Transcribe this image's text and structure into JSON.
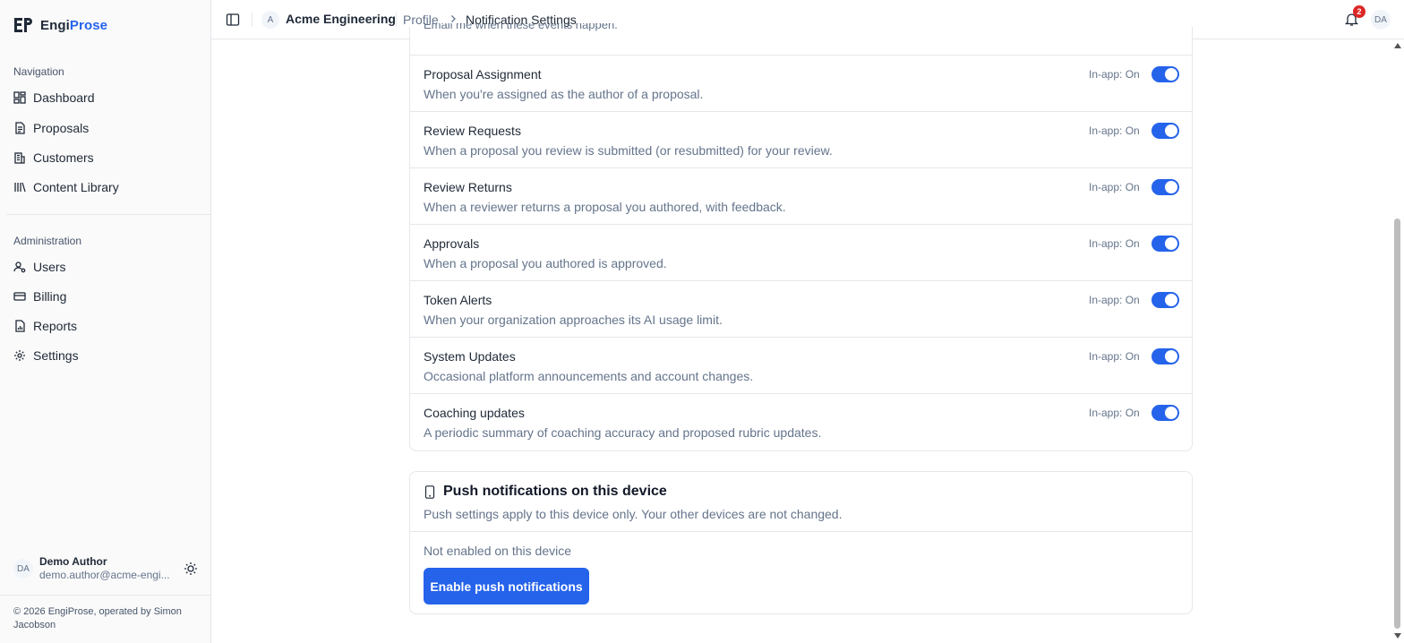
{
  "brand": {
    "name_prefix": "Engi",
    "name_accent": "Prose",
    "accent_color": "#2563eb"
  },
  "sidebar": {
    "nav_label": "Navigation",
    "nav_items": [
      {
        "label": "Dashboard",
        "icon": "dashboard-icon"
      },
      {
        "label": "Proposals",
        "icon": "document-icon"
      },
      {
        "label": "Customers",
        "icon": "building-icon"
      },
      {
        "label": "Content Library",
        "icon": "library-icon"
      }
    ],
    "admin_label": "Administration",
    "admin_items": [
      {
        "label": "Users",
        "icon": "user-gear-icon"
      },
      {
        "label": "Billing",
        "icon": "credit-card-icon"
      },
      {
        "label": "Reports",
        "icon": "report-icon"
      },
      {
        "label": "Settings",
        "icon": "gear-icon"
      }
    ],
    "user": {
      "initials": "DA",
      "name": "Demo Author",
      "email": "demo.author@acme-engi..."
    },
    "footer": "© 2026 EngiProse, operated by Simon Jacobson"
  },
  "header": {
    "org_initial": "A",
    "org_name": "Acme Engineering",
    "breadcrumb_parent": "Profile",
    "breadcrumb_current": "Notification Settings",
    "notification_count": "2",
    "user_initials": "DA"
  },
  "events": {
    "clipped_text": "Email me when these events happen.",
    "rows": [
      {
        "title": "Proposal Assignment",
        "desc": "When you're assigned as the author of a proposal.",
        "inapp": "In-app: On",
        "enabled": true
      },
      {
        "title": "Review Requests",
        "desc": "When a proposal you review is submitted (or resubmitted) for your review.",
        "inapp": "In-app: On",
        "enabled": true
      },
      {
        "title": "Review Returns",
        "desc": "When a reviewer returns a proposal you authored, with feedback.",
        "inapp": "In-app: On",
        "enabled": true
      },
      {
        "title": "Approvals",
        "desc": "When a proposal you authored is approved.",
        "inapp": "In-app: On",
        "enabled": true
      },
      {
        "title": "Token Alerts",
        "desc": "When your organization approaches its AI usage limit.",
        "inapp": "In-app: On",
        "enabled": true
      },
      {
        "title": "System Updates",
        "desc": "Occasional platform announcements and account changes.",
        "inapp": "In-app: On",
        "enabled": true
      },
      {
        "title": "Coaching updates",
        "desc": "A periodic summary of coaching accuracy and proposed rubric updates.",
        "inapp": "In-app: On",
        "enabled": true
      }
    ]
  },
  "push": {
    "title": "Push notifications on this device",
    "desc": "Push settings apply to this device only. Your other devices are not changed.",
    "status": "Not enabled on this device",
    "button": "Enable push notifications"
  }
}
